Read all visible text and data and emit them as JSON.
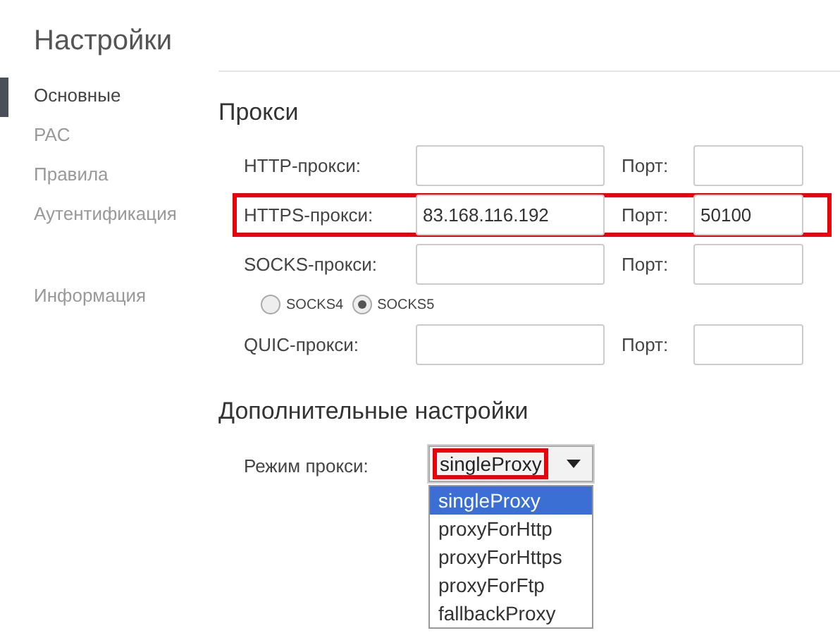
{
  "sidebar": {
    "title": "Настройки",
    "items": [
      {
        "label": "Основные",
        "selected": true
      },
      {
        "label": "PAC",
        "selected": false
      },
      {
        "label": "Правила",
        "selected": false
      },
      {
        "label": "Аутентификация",
        "selected": false
      }
    ],
    "info_item": {
      "label": "Информация",
      "selected": false
    }
  },
  "proxy_section": {
    "title": "Прокси",
    "rows": [
      {
        "kind": "proxy",
        "label": "HTTP-прокси:",
        "value": "",
        "port_label": "Порт:",
        "port": "",
        "highlighted": false
      },
      {
        "kind": "proxy",
        "label": "HTTPS-прокси:",
        "value": "83.168.116.192",
        "port_label": "Порт:",
        "port": "50100",
        "highlighted": true
      },
      {
        "kind": "proxy",
        "label": "SOCKS-прокси:",
        "value": "",
        "port_label": "Порт:",
        "port": "",
        "highlighted": false
      },
      {
        "kind": "radios",
        "options": [
          {
            "label": "SOCKS4",
            "selected": false
          },
          {
            "label": "SOCKS5",
            "selected": true
          }
        ]
      },
      {
        "kind": "proxy",
        "label": "QUIC-прокси:",
        "value": "",
        "port_label": "Порт:",
        "port": "",
        "highlighted": false
      }
    ]
  },
  "advanced_section": {
    "title": "Дополнительные настройки",
    "mode_label": "Режим прокси:",
    "mode_value": "singleProxy",
    "mode_highlighted": true,
    "expanded": true,
    "options": [
      {
        "label": "singleProxy",
        "selected": true
      },
      {
        "label": "proxyForHttp",
        "selected": false
      },
      {
        "label": "proxyForHttps",
        "selected": false
      },
      {
        "label": "proxyForFtp",
        "selected": false
      },
      {
        "label": "fallbackProxy",
        "selected": false
      }
    ]
  }
}
